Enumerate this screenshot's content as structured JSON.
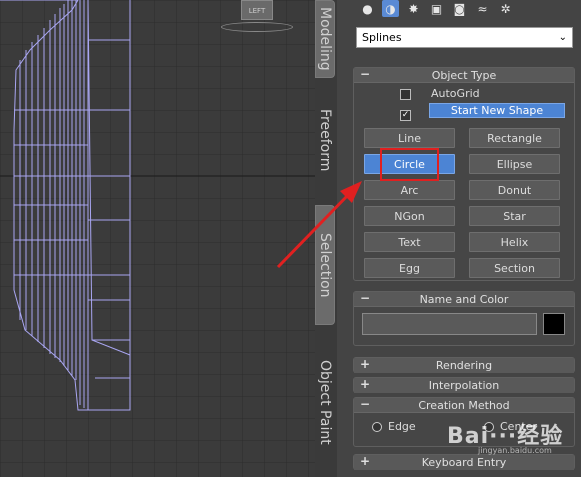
{
  "viewport": {
    "viewcube_label": "LEFT"
  },
  "side_tabs": [
    "Modeling",
    "Freeform",
    "Selection",
    "Object Paint"
  ],
  "toolbar_icons": [
    "sphere-icon",
    "shapes-icon",
    "lights-icon",
    "cameras-icon",
    "helpers-icon",
    "spacewarps-icon",
    "systems-icon"
  ],
  "category_dropdown": {
    "value": "Splines"
  },
  "object_type": {
    "title": "Object Type",
    "sign": "−",
    "autogrid_label": "AutoGrid",
    "start_new_shape_label": "Start New Shape",
    "start_new_shape_checked": true,
    "buttons": [
      "Line",
      "Rectangle",
      "Circle",
      "Ellipse",
      "Arc",
      "Donut",
      "NGon",
      "Star",
      "Text",
      "Helix",
      "Egg",
      "Section"
    ],
    "selected_button": "Circle"
  },
  "name_and_color": {
    "title": "Name and Color",
    "sign": "−",
    "name_value": "",
    "color": "#000000"
  },
  "rendering": {
    "title": "Rendering",
    "sign": "+"
  },
  "interpolation": {
    "title": "Interpolation",
    "sign": "+"
  },
  "creation_method": {
    "title": "Creation Method",
    "sign": "−",
    "option_edge": "Edge",
    "option_center": "Center"
  },
  "keyboard_entry": {
    "title": "Keyboard Entry",
    "sign": "+"
  },
  "watermark": {
    "text": "Bai···经验",
    "sub": "jingyan.baidu.com"
  },
  "colors": {
    "accent": "#4c84d4",
    "annotation": "#e02020",
    "mesh": "#a9a6f2"
  }
}
